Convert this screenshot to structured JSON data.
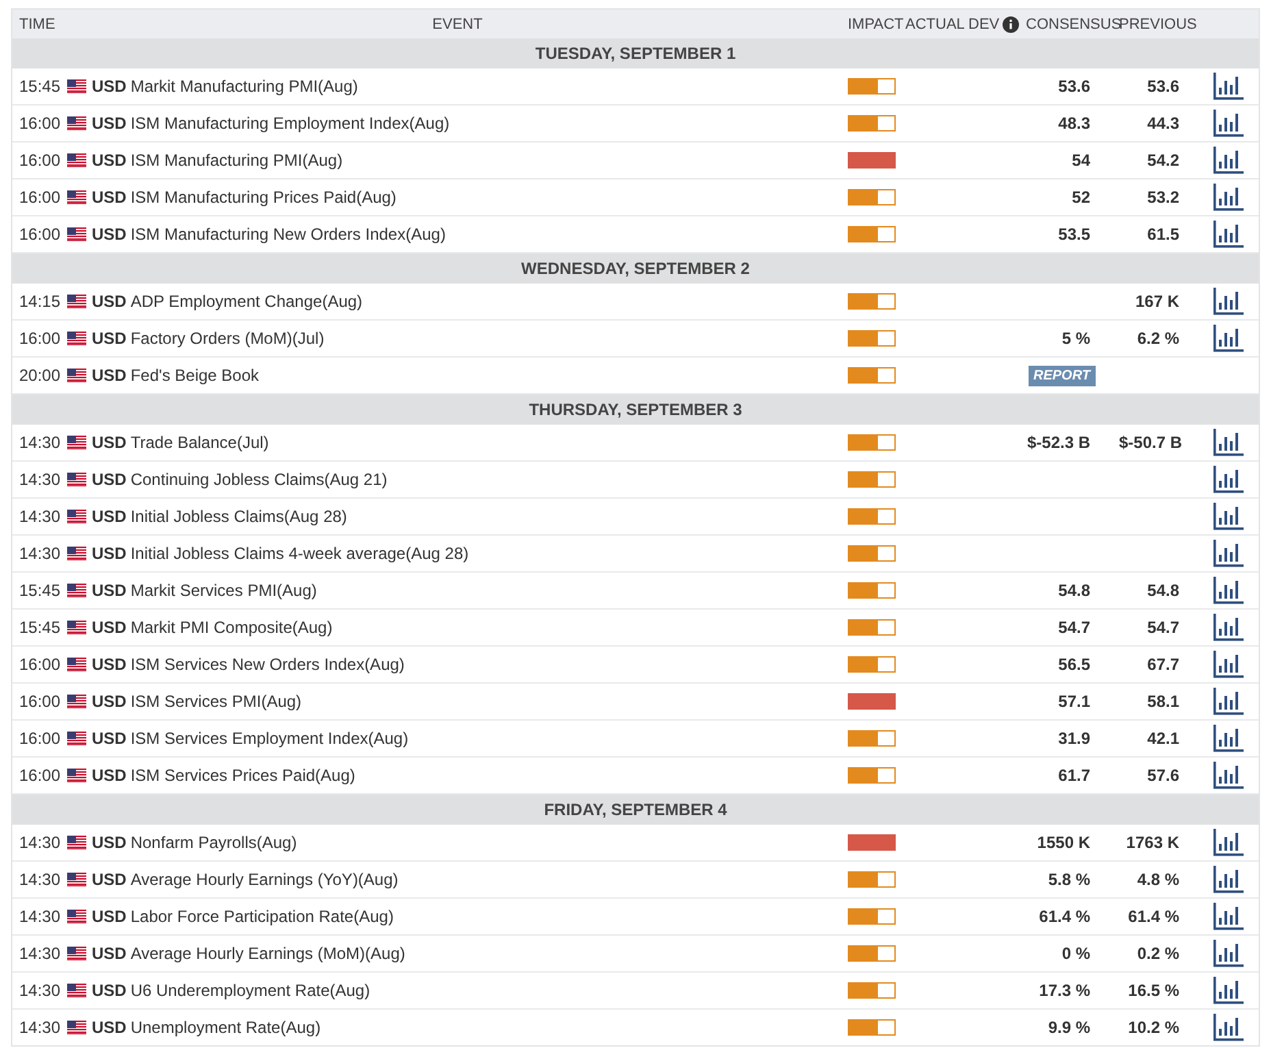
{
  "columns": [
    "TIME",
    "EVENT",
    "IMPACT",
    "ACTUAL",
    "DEV",
    "CONSENSUS",
    "PREVIOUS"
  ],
  "days": [
    {
      "date": "TUESDAY, SEPTEMBER 1",
      "events": [
        {
          "time": "15:45",
          "currency": "USD",
          "name": "Markit Manufacturing PMI(Aug)",
          "level": 0.65,
          "consensus": "53.6",
          "previous": "53.6",
          "chart": true
        },
        {
          "time": "16:00",
          "currency": "USD",
          "name": "ISM Manufacturing Employment Index(Aug)",
          "level": 0.65,
          "consensus": "48.3",
          "previous": "44.3",
          "chart": true
        },
        {
          "time": "16:00",
          "currency": "USD",
          "name": "ISM Manufacturing PMI(Aug)",
          "level": 1,
          "consensus": "54",
          "previous": "54.2",
          "chart": true
        },
        {
          "time": "16:00",
          "currency": "USD",
          "name": "ISM Manufacturing Prices Paid(Aug)",
          "level": 0.65,
          "consensus": "52",
          "previous": "53.2",
          "chart": true
        },
        {
          "time": "16:00",
          "currency": "USD",
          "name": "ISM Manufacturing New Orders Index(Aug)",
          "level": 0.65,
          "consensus": "53.5",
          "previous": "61.5",
          "chart": true
        }
      ]
    },
    {
      "date": "WEDNESDAY, SEPTEMBER 2",
      "events": [
        {
          "time": "14:15",
          "currency": "USD",
          "name": "ADP Employment Change(Aug)",
          "level": 0.65,
          "previous": "167 K",
          "chart": true
        },
        {
          "time": "16:00",
          "currency": "USD",
          "name": "Factory Orders (MoM)(Jul)",
          "level": 0.65,
          "consensus": "5 %",
          "previous": "6.2 %",
          "chart": true
        },
        {
          "time": "20:00",
          "currency": "USD",
          "name": "Fed's Beige Book",
          "level": 0.65,
          "badge": "REPORT",
          "chart": false
        }
      ]
    },
    {
      "date": "THURSDAY, SEPTEMBER 3",
      "events": [
        {
          "time": "14:30",
          "currency": "USD",
          "name": "Trade Balance(Jul)",
          "level": 0.65,
          "consensus": "$-52.3 B",
          "previous": "$-50.7 B",
          "chart": true
        },
        {
          "time": "14:30",
          "currency": "USD",
          "name": "Continuing Jobless Claims(Aug 21)",
          "level": 0.65,
          "chart": true
        },
        {
          "time": "14:30",
          "currency": "USD",
          "name": "Initial Jobless Claims(Aug 28)",
          "level": 0.65,
          "chart": true
        },
        {
          "time": "14:30",
          "currency": "USD",
          "name": "Initial Jobless Claims 4-week average(Aug 28)",
          "level": 0.65,
          "chart": true
        },
        {
          "time": "15:45",
          "currency": "USD",
          "name": "Markit Services PMI(Aug)",
          "level": 0.65,
          "consensus": "54.8",
          "previous": "54.8",
          "chart": true
        },
        {
          "time": "15:45",
          "currency": "USD",
          "name": "Markit PMI Composite(Aug)",
          "level": 0.65,
          "consensus": "54.7",
          "previous": "54.7",
          "chart": true
        },
        {
          "time": "16:00",
          "currency": "USD",
          "name": "ISM Services New Orders Index(Aug)",
          "level": 0.65,
          "consensus": "56.5",
          "previous": "67.7",
          "chart": true
        },
        {
          "time": "16:00",
          "currency": "USD",
          "name": "ISM Services PMI(Aug)",
          "level": 1,
          "consensus": "57.1",
          "previous": "58.1",
          "chart": true
        },
        {
          "time": "16:00",
          "currency": "USD",
          "name": "ISM Services Employment Index(Aug)",
          "level": 0.65,
          "consensus": "31.9",
          "previous": "42.1",
          "chart": true
        },
        {
          "time": "16:00",
          "currency": "USD",
          "name": "ISM Services Prices Paid(Aug)",
          "level": 0.65,
          "consensus": "61.7",
          "previous": "57.6",
          "chart": true
        }
      ]
    },
    {
      "date": "FRIDAY, SEPTEMBER 4",
      "events": [
        {
          "time": "14:30",
          "currency": "USD",
          "name": "Nonfarm Payrolls(Aug)",
          "level": 1,
          "consensus": "1550 K",
          "previous": "1763 K",
          "chart": true
        },
        {
          "time": "14:30",
          "currency": "USD",
          "name": "Average Hourly Earnings (YoY)(Aug)",
          "level": 0.65,
          "consensus": "5.8 %",
          "previous": "4.8 %",
          "chart": true
        },
        {
          "time": "14:30",
          "currency": "USD",
          "name": "Labor Force Participation Rate(Aug)",
          "level": 0.65,
          "consensus": "61.4 %",
          "previous": "61.4 %",
          "chart": true
        },
        {
          "time": "14:30",
          "currency": "USD",
          "name": "Average Hourly Earnings (MoM)(Aug)",
          "level": 0.65,
          "consensus": "0 %",
          "previous": "0.2 %",
          "chart": true
        },
        {
          "time": "14:30",
          "currency": "USD",
          "name": "U6 Underemployment Rate(Aug)",
          "level": 0.65,
          "consensus": "17.3 %",
          "previous": "16.5 %",
          "chart": true
        },
        {
          "time": "14:30",
          "currency": "USD",
          "name": "Unemployment Rate(Aug)",
          "level": 0.65,
          "consensus": "9.9 %",
          "previous": "10.2 %",
          "chart": true
        }
      ]
    }
  ]
}
